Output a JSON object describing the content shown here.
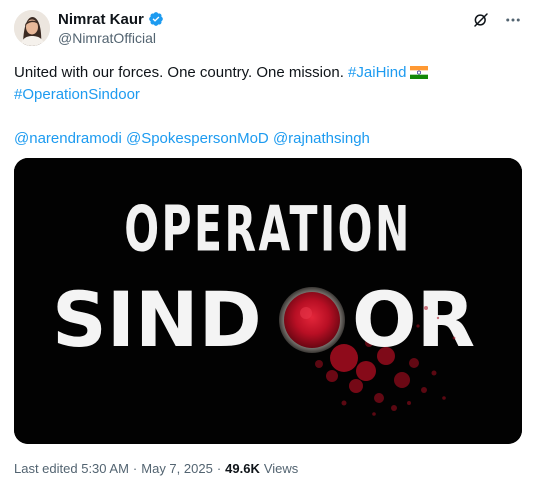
{
  "author": {
    "display_name": "Nimrat Kaur",
    "handle": "@NimratOfficial",
    "verified": true
  },
  "tweet": {
    "text_plain": "United with our forces. One country. One mission.",
    "hashtag_1": "#JaiHind",
    "hashtag_2": "#OperationSindoor",
    "mention_1": "@narendramodi",
    "mention_2": "@SpokespersonMoD",
    "mention_3": "@rajnathsingh",
    "emoji": "india-flag"
  },
  "media": {
    "title_top": "OPERATION",
    "title_bottom_left": "SIND",
    "title_bottom_right": "OR"
  },
  "meta": {
    "edited_label": "Last edited 5:30 AM",
    "separator": "·",
    "date": "May 7, 2025",
    "views_count": "49.6K",
    "views_label": "Views"
  },
  "colors": {
    "link": "#1d9bf0",
    "secondary_text": "#536471",
    "verified_badge": "#1d9bf0",
    "media_background": "#020202",
    "sindoor_red": "#c8102e"
  },
  "icons": {
    "grok": "grok-icon",
    "more": "more-icon",
    "verified": "verified-badge-icon"
  }
}
